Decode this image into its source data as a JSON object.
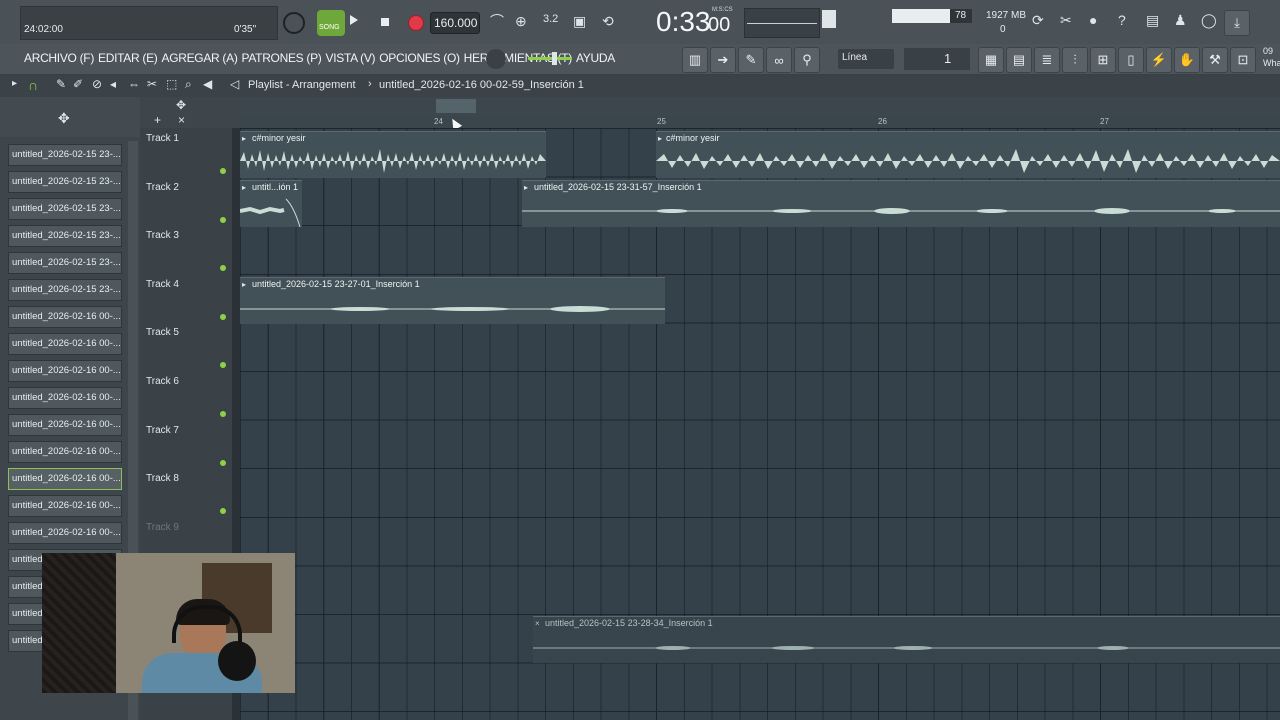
{
  "topbar": {
    "position_time": "24:02:00",
    "small_time": "0'35\"",
    "song_label": "SONG",
    "tempo": "160.000",
    "main_time": "0:33",
    "main_time_sub": "00",
    "time_format": "M:S:CS",
    "cpu_value": "78",
    "memory": "1927 MB",
    "poly": "0"
  },
  "menu": {
    "items": [
      "ARCHIVO (F)",
      "EDITAR (E)",
      "AGREGAR (A)",
      "PATRONES (P)",
      "VISTA (V)",
      "OPCIONES (O)",
      "HERRAMIENTAS (T)",
      "AYUDA"
    ],
    "snap_label": "Línea",
    "pattern_number": "1",
    "corner_text_1": "09",
    "corner_text_2": "Wha"
  },
  "playlist": {
    "title": "Playlist - Arrangement",
    "separator": "›",
    "pattern_name": "untitled_2026-02-16 00-02-59_Inserción 1"
  },
  "ruler": {
    "bars": [
      "24",
      "25",
      "26",
      "27"
    ]
  },
  "pattern_list": [
    "untitled_2026-02-15 23-...",
    "untitled_2026-02-15 23-...",
    "untitled_2026-02-15 23-...",
    "untitled_2026-02-15 23-...",
    "untitled_2026-02-15 23-...",
    "untitled_2026-02-15 23-...",
    "untitled_2026-02-16 00-...",
    "untitled_2026-02-16 00-...",
    "untitled_2026-02-16 00-...",
    "untitled_2026-02-16 00-...",
    "untitled_2026-02-16 00-...",
    "untitled_2026-02-16 00-...",
    "untitled_2026-02-16 00-...",
    "untitled_2026-02-16 00-...",
    "untitled_2026-02-16 00-...",
    "untitled",
    "untitled",
    "untitled",
    "untitled"
  ],
  "tracks": [
    "Track 1",
    "Track 2",
    "Track 3",
    "Track 4",
    "Track 5",
    "Track 6",
    "Track 7",
    "Track 8",
    "Track 9"
  ],
  "clips": [
    {
      "title": "c#minor yesir"
    },
    {
      "title": "c#minor yesir"
    },
    {
      "title": "untitl...ión 1"
    },
    {
      "title": "untitled_2026-02-15 23-31-57_Inserción 1"
    },
    {
      "title": "untitled_2026-02-15 23-27-01_Inserción 1"
    },
    {
      "title": "untitled_2026-02-15 23-28-34_Inserción 1"
    }
  ],
  "colors": {
    "accent_green": "#8fd04a",
    "record_red": "#e0394a",
    "waveform": "#c9ddd6"
  }
}
